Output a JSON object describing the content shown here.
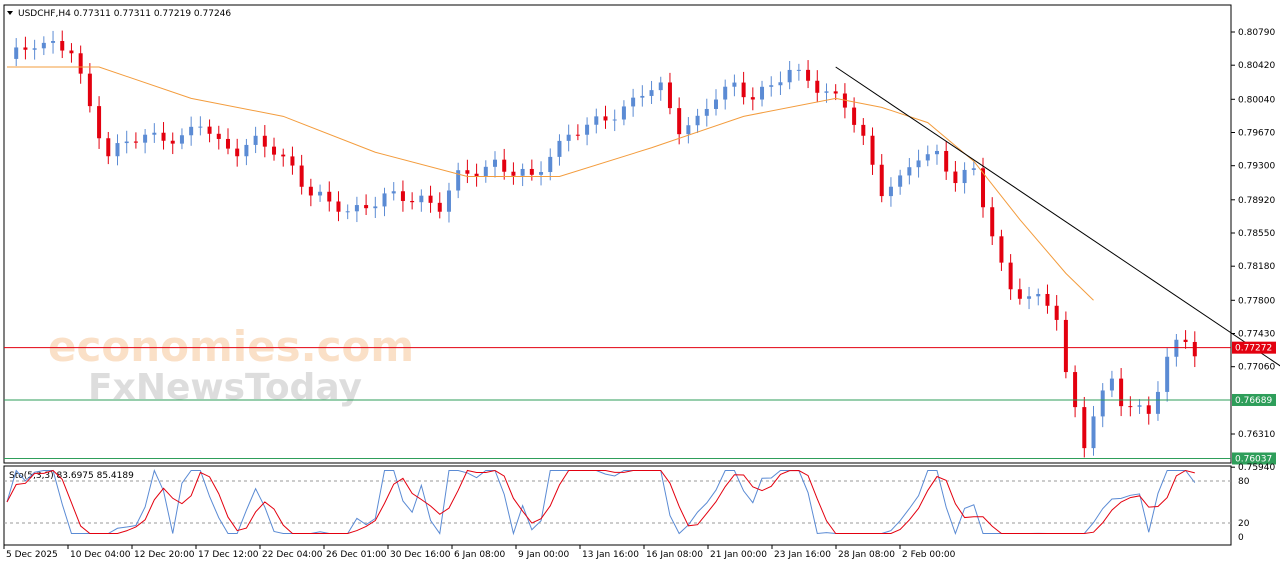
{
  "header": {
    "symbol_info": "USDCHF,H4  0.77311 0.77311 0.77219 0.77246"
  },
  "watermark": {
    "brand1": "economies.com",
    "brand2": "FxNewsToday"
  },
  "colors": {
    "bull": "#5b8bd4",
    "bear": "#e3000f",
    "ma": "#f39c3d",
    "trendline": "#000000",
    "current_price_line": "#e3000f",
    "support_line": "#2e9e5a",
    "stoch_main": "#5b8bd4",
    "stoch_signal": "#e3000f"
  },
  "chart_data": [
    {
      "type": "candlestick",
      "title": "USDCHF,H4",
      "y_ticks": [
        "0.80790",
        "0.80420",
        "0.80040",
        "0.79670",
        "0.79300",
        "0.78920",
        "0.78550",
        "0.78180",
        "0.77800",
        "0.77430",
        "0.77060",
        "0.76310",
        "0.75940"
      ],
      "ylim": [
        0.7594,
        0.8079
      ],
      "x_ticks": [
        "5 Dec 2025",
        "10 Dec 04:00",
        "12 Dec 20:00",
        "17 Dec 12:00",
        "22 Dec 04:00",
        "26 Dec 01:00",
        "30 Dec 16:00",
        "6 Jan 08:00",
        "9 Jan 00:00",
        "13 Jan 16:00",
        "16 Jan 08:00",
        "21 Jan 00:00",
        "23 Jan 16:00",
        "28 Jan 08:00",
        "2 Feb 00:00"
      ],
      "close_path": [
        [
          0,
          0.8045
        ],
        [
          3,
          0.807
        ],
        [
          5,
          0.8065
        ],
        [
          7,
          0.8055
        ],
        [
          9,
          0.7995
        ],
        [
          11,
          0.7945
        ],
        [
          13,
          0.7955
        ],
        [
          15,
          0.796
        ],
        [
          17,
          0.7965
        ],
        [
          19,
          0.796
        ],
        [
          21,
          0.7975
        ],
        [
          23,
          0.7955
        ],
        [
          25,
          0.795
        ],
        [
          27,
          0.7955
        ],
        [
          29,
          0.7945
        ],
        [
          31,
          0.793
        ],
        [
          33,
          0.79
        ],
        [
          35,
          0.7885
        ],
        [
          37,
          0.788
        ],
        [
          39,
          0.7888
        ],
        [
          41,
          0.7893
        ],
        [
          43,
          0.7893
        ],
        [
          45,
          0.7895
        ],
        [
          47,
          0.7885
        ],
        [
          49,
          0.7915
        ],
        [
          51,
          0.7925
        ],
        [
          53,
          0.7935
        ],
        [
          55,
          0.792
        ],
        [
          57,
          0.7915
        ],
        [
          59,
          0.7945
        ],
        [
          61,
          0.7965
        ],
        [
          63,
          0.797
        ],
        [
          65,
          0.7985
        ],
        [
          67,
          0.7995
        ],
        [
          69,
          0.801
        ],
        [
          71,
          0.8015
        ],
        [
          73,
          0.7975
        ],
        [
          75,
          0.798
        ],
        [
          77,
          0.8005
        ],
        [
          79,
          0.802
        ],
        [
          81,
          0.801
        ],
        [
          83,
          0.8015
        ],
        [
          85,
          0.8035
        ],
        [
          87,
          0.803
        ],
        [
          89,
          0.801
        ],
        [
          91,
          0.7995
        ],
        [
          93,
          0.796
        ],
        [
          95,
          0.7905
        ],
        [
          97,
          0.791
        ],
        [
          99,
          0.794
        ],
        [
          101,
          0.7945
        ],
        [
          103,
          0.7915
        ],
        [
          105,
          0.792
        ],
        [
          107,
          0.7855
        ],
        [
          108,
          0.782
        ],
        [
          109,
          0.7795
        ],
        [
          111,
          0.778
        ],
        [
          113,
          0.7775
        ],
        [
          114,
          0.7765
        ],
        [
          115,
          0.77
        ],
        [
          116,
          0.766
        ],
        [
          117,
          0.762
        ],
        [
          118,
          0.765
        ],
        [
          119,
          0.767
        ],
        [
          120,
          0.769
        ],
        [
          121,
          0.767
        ],
        [
          122,
          0.7665
        ],
        [
          123,
          0.766
        ],
        [
          124,
          0.7655
        ],
        [
          125,
          0.768
        ],
        [
          126,
          0.771
        ],
        [
          127,
          0.773
        ],
        [
          128,
          0.774
        ],
        [
          129,
          0.7725
        ]
      ],
      "moving_average_path": [
        [
          0,
          0.804
        ],
        [
          10,
          0.804
        ],
        [
          20,
          0.8005
        ],
        [
          30,
          0.7985
        ],
        [
          40,
          0.7945
        ],
        [
          50,
          0.7918
        ],
        [
          60,
          0.7918
        ],
        [
          70,
          0.795
        ],
        [
          80,
          0.7985
        ],
        [
          90,
          0.8005
        ],
        [
          95,
          0.7995
        ],
        [
          100,
          0.7978
        ],
        [
          105,
          0.7935
        ],
        [
          110,
          0.787
        ],
        [
          115,
          0.781
        ],
        [
          118,
          0.778
        ]
      ],
      "trendline": {
        "from": [
          90,
          0.804
        ],
        "to": [
          140,
          0.7695
        ]
      },
      "price_labels": [
        {
          "text": "0.77272",
          "value": 0.77272,
          "kind": "current"
        },
        {
          "text": "0.76689",
          "value": 0.76689,
          "kind": "support"
        },
        {
          "text": "0.76037",
          "value": 0.76037,
          "kind": "support"
        }
      ]
    },
    {
      "type": "line",
      "title": "Sto(5,3,3) 83.6975 85.4189",
      "y_ticks": [
        "80",
        "20",
        "0"
      ],
      "ylim": [
        0,
        100
      ],
      "levels": [
        20,
        80
      ]
    }
  ]
}
